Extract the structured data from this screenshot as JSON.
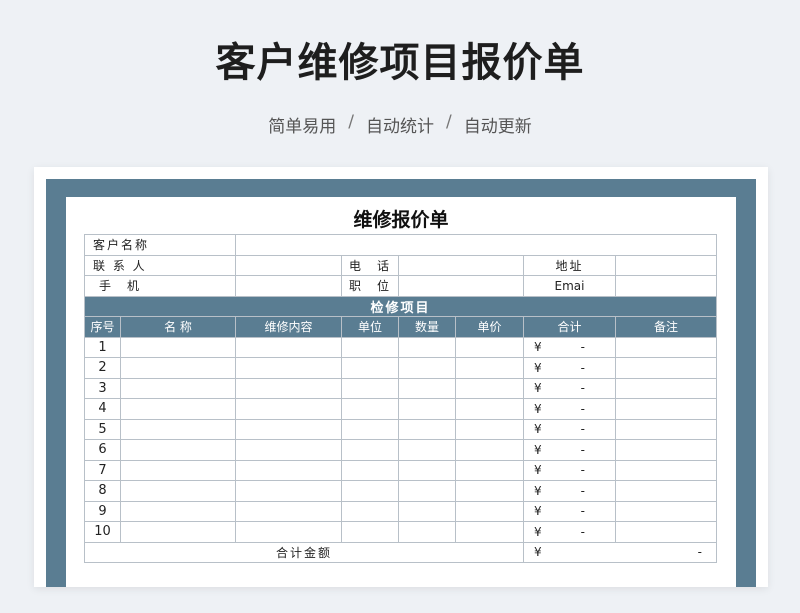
{
  "header": {
    "title": "客户维修项目报价单",
    "features": [
      "简单易用",
      "自动统计",
      "自动更新"
    ],
    "separator": "/"
  },
  "form": {
    "sheet_title": "维修报价单",
    "customer_name_label": "客户名称",
    "contact_label": "联 系 人",
    "phone_label": "电　话",
    "address_label": "地址",
    "mobile_label": "手　机",
    "position_label": "职　位",
    "email_label": "Emai",
    "section_title": "检修项目",
    "columns": [
      "序号",
      "名 称",
      "维修内容",
      "单位",
      "数量",
      "单价",
      "合计",
      "备注"
    ],
    "rows": [
      {
        "no": "1",
        "currency": "¥",
        "amount": "-"
      },
      {
        "no": "2",
        "currency": "¥",
        "amount": "-"
      },
      {
        "no": "3",
        "currency": "¥",
        "amount": "-"
      },
      {
        "no": "4",
        "currency": "¥",
        "amount": "-"
      },
      {
        "no": "5",
        "currency": "¥",
        "amount": "-"
      },
      {
        "no": "6",
        "currency": "¥",
        "amount": "-"
      },
      {
        "no": "7",
        "currency": "¥",
        "amount": "-"
      },
      {
        "no": "8",
        "currency": "¥",
        "amount": "-"
      },
      {
        "no": "9",
        "currency": "¥",
        "amount": "-"
      },
      {
        "no": "10",
        "currency": "¥",
        "amount": "-"
      }
    ],
    "total_label": "合计金额",
    "total_currency": "¥",
    "total_amount": "-"
  },
  "colors": {
    "accent": "#5a7d92",
    "background": "#eef1f5"
  }
}
